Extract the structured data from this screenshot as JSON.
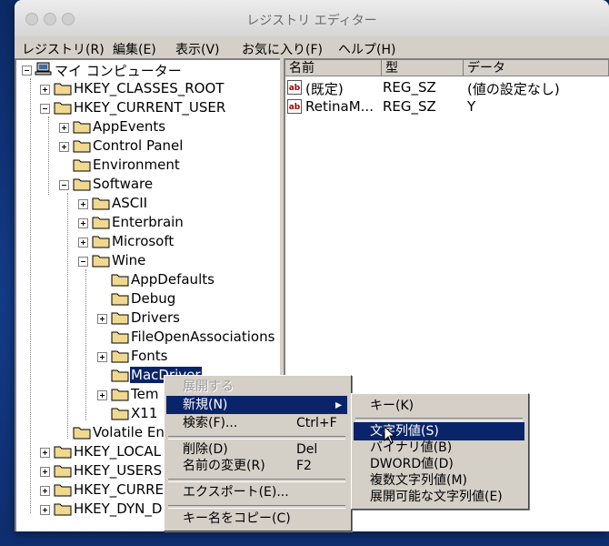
{
  "window": {
    "title": "レジストリ エディター"
  },
  "menubar": [
    "レジストリ(R)",
    "編集(E)",
    "表示(V)",
    "お気に入り(F)",
    "ヘルプ(H)"
  ],
  "tree": {
    "root": "マイ コンピューター",
    "hkcr": "HKEY_CLASSES_ROOT",
    "hkcu": "HKEY_CURRENT_USER",
    "appevents": "AppEvents",
    "control_panel": "Control Panel",
    "environment": "Environment",
    "software": "Software",
    "ascii": "ASCII",
    "enterbrain": "Enterbrain",
    "microsoft": "Microsoft",
    "wine": "Wine",
    "appdefaults": "AppDefaults",
    "debug": "Debug",
    "drivers": "Drivers",
    "fileopen": "FileOpenAssociations",
    "fonts": "Fonts",
    "macdriver": "MacDriver",
    "temp": "Tem",
    "x11": "X11",
    "volatile": "Volatile En",
    "hklm": "HKEY_LOCAL",
    "hku": "HKEY_USERS",
    "hkcc": "HKEY_CURRE",
    "hkdd": "HKEY_DYN_D"
  },
  "list": {
    "headers": [
      "名前",
      "型",
      "データ"
    ],
    "rows": [
      {
        "name": "(既定)",
        "type": "REG_SZ",
        "data": "(値の設定なし)"
      },
      {
        "name": "RetinaM...",
        "type": "REG_SZ",
        "data": "Y"
      }
    ]
  },
  "context_menu": {
    "expand": "展開する",
    "new": "新規(N)",
    "find": "検索(F)...",
    "find_shortcut": "Ctrl+F",
    "delete": "削除(D)",
    "delete_shortcut": "Del",
    "rename": "名前の変更(R)",
    "rename_shortcut": "F2",
    "export": "エクスポート(E)...",
    "copy_key": "キー名をコピー(C)"
  },
  "submenu": {
    "key": "キー(K)",
    "string": "文字列値(S)",
    "binary": "バイナリ値(B)",
    "dword": "DWORD値(D)",
    "multi": "複数文字列値(M)",
    "expandable": "展開可能な文字列値(E)"
  },
  "colors": {
    "selection": "#0a246a",
    "chrome": "#d4d0c8",
    "folder": "#f0d890"
  }
}
